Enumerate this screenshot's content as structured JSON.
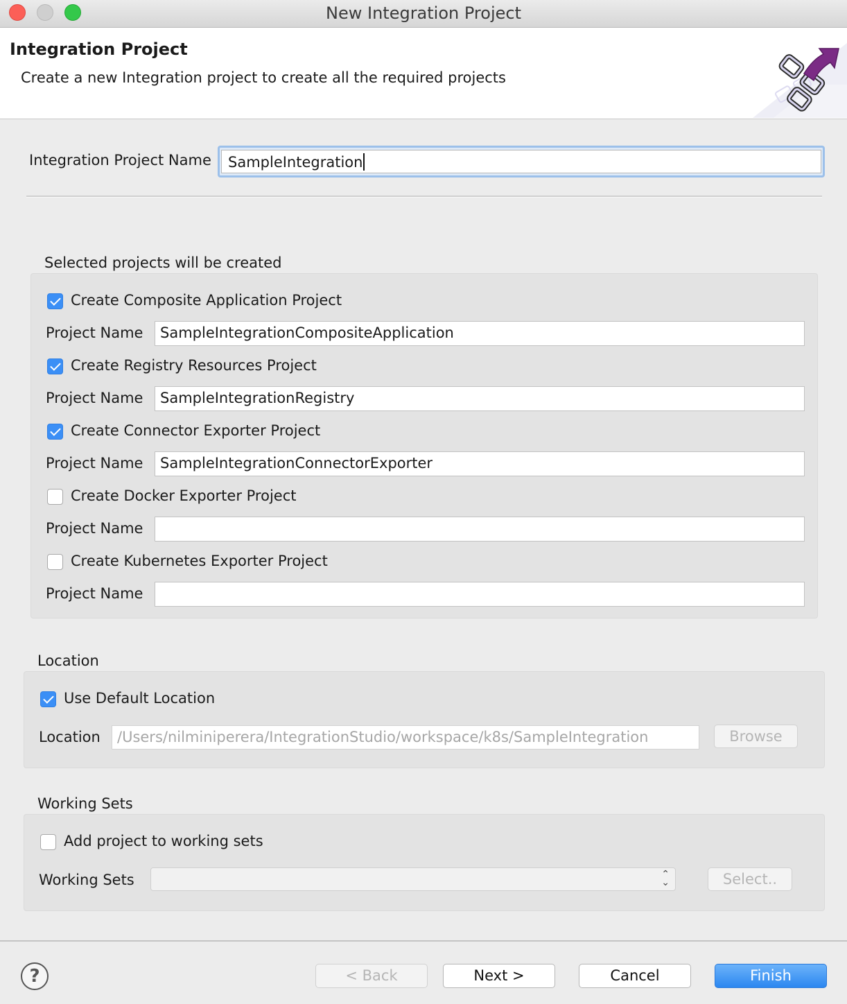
{
  "window": {
    "title": "New Integration Project",
    "controls": [
      "close",
      "minimize",
      "maximize"
    ]
  },
  "header": {
    "title": "Integration Project",
    "description": "Create a new Integration project to create all the required projects",
    "icon": "wizard-banner-icon"
  },
  "project_name": {
    "label": "Integration Project Name",
    "value": "SampleIntegration"
  },
  "projects_group": {
    "title": "Selected projects will be created",
    "items": [
      {
        "checkbox_label": "Create Composite Application Project",
        "checked": true,
        "name_label": "Project Name",
        "name_value": "SampleIntegrationCompositeApplication"
      },
      {
        "checkbox_label": "Create Registry Resources Project",
        "checked": true,
        "name_label": "Project Name",
        "name_value": "SampleIntegrationRegistry"
      },
      {
        "checkbox_label": "Create Connector Exporter Project",
        "checked": true,
        "name_label": "Project Name",
        "name_value": "SampleIntegrationConnectorExporter"
      },
      {
        "checkbox_label": "Create Docker Exporter Project",
        "checked": false,
        "name_label": "Project Name",
        "name_value": ""
      },
      {
        "checkbox_label": "Create Kubernetes Exporter Project",
        "checked": false,
        "name_label": "Project Name",
        "name_value": ""
      }
    ]
  },
  "location_group": {
    "title": "Location",
    "use_default_label": "Use Default Location",
    "use_default_checked": true,
    "location_label": "Location",
    "location_value": "/Users/nilminiperera/IntegrationStudio/workspace/k8s/SampleIntegration",
    "browse_label": "Browse"
  },
  "working_sets_group": {
    "title": "Working Sets",
    "add_label": "Add project to working sets",
    "add_checked": false,
    "sets_label": "Working Sets",
    "sets_value": "",
    "select_label": "Select.."
  },
  "footer": {
    "help_icon": "question-mark-icon",
    "help_symbol": "?",
    "back_label": "< Back",
    "next_label": "Next >",
    "cancel_label": "Cancel",
    "finish_label": "Finish"
  },
  "colors": {
    "accent": "#3b8ff6",
    "finish_button": "#2c87f0",
    "focus_ring": "#9cc0ea"
  }
}
